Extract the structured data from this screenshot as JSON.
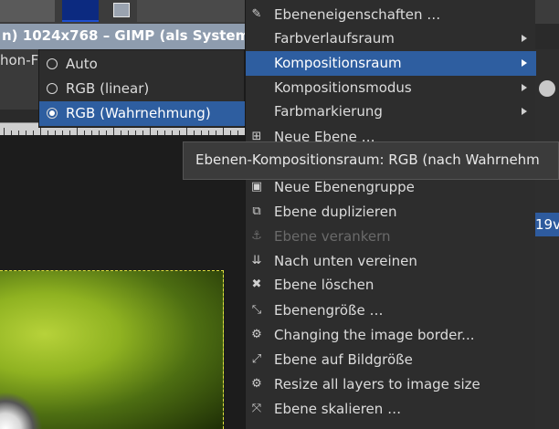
{
  "window": {
    "title": "n) 1024x768 – GIMP (als System",
    "cut_label": "hon-F",
    "right_cut_label": "19v"
  },
  "submenu": {
    "items": [
      {
        "label": "Auto",
        "selected": false
      },
      {
        "label": "RGB (linear)",
        "selected": false
      },
      {
        "label": "RGB (Wahrnehmung)",
        "selected": true
      }
    ]
  },
  "menu": {
    "items": [
      {
        "label": "Ebeneneigenschaften …",
        "icon": "layer-properties-icon",
        "glyph": "✎",
        "submenu": false,
        "disabled": false,
        "highlighted": false
      },
      {
        "label": "Farbverlaufsraum",
        "icon": "",
        "glyph": "",
        "submenu": true,
        "disabled": false,
        "highlighted": false
      },
      {
        "label": "Kompositionsraum",
        "icon": "",
        "glyph": "",
        "submenu": true,
        "disabled": false,
        "highlighted": true
      },
      {
        "label": "Kompositionsmodus",
        "icon": "",
        "glyph": "",
        "submenu": true,
        "disabled": false,
        "highlighted": false
      },
      {
        "label": "Farbmarkierung",
        "icon": "",
        "glyph": "",
        "submenu": true,
        "disabled": false,
        "highlighted": false
      },
      {
        "label": "Neue Ebene …",
        "icon": "new-layer-icon",
        "glyph": "⊞",
        "submenu": false,
        "disabled": false,
        "highlighted": false
      },
      {
        "label": "",
        "icon": "",
        "glyph": "",
        "submenu": false,
        "disabled": false,
        "highlighted": false
      },
      {
        "label": "Neue Ebenengruppe",
        "icon": "new-layer-group-icon",
        "glyph": "▣",
        "submenu": false,
        "disabled": false,
        "highlighted": false
      },
      {
        "label": "Ebene duplizieren",
        "icon": "duplicate-layer-icon",
        "glyph": "⧉",
        "submenu": false,
        "disabled": false,
        "highlighted": false
      },
      {
        "label": "Ebene verankern",
        "icon": "anchor-icon",
        "glyph": "⚓",
        "submenu": false,
        "disabled": true,
        "highlighted": false
      },
      {
        "label": "Nach unten vereinen",
        "icon": "merge-down-icon",
        "glyph": "⇊",
        "submenu": false,
        "disabled": false,
        "highlighted": false
      },
      {
        "label": "Ebene löschen",
        "icon": "delete-layer-icon",
        "glyph": "✖",
        "submenu": false,
        "disabled": false,
        "highlighted": false
      },
      {
        "label": "Ebenengröße …",
        "icon": "layer-size-icon",
        "glyph": "⤡",
        "submenu": false,
        "disabled": false,
        "highlighted": false
      },
      {
        "label": "Changing the image border...",
        "icon": "gear-icon",
        "glyph": "⚙",
        "submenu": false,
        "disabled": false,
        "highlighted": false
      },
      {
        "label": "Ebene auf Bildgröße",
        "icon": "layer-to-image-size-icon",
        "glyph": "⤢",
        "submenu": false,
        "disabled": false,
        "highlighted": false
      },
      {
        "label": "Resize all layers to image size",
        "icon": "gear-icon",
        "glyph": "⚙",
        "submenu": false,
        "disabled": false,
        "highlighted": false
      },
      {
        "label": "Ebene skalieren …",
        "icon": "scale-layer-icon",
        "glyph": "⤧",
        "submenu": false,
        "disabled": false,
        "highlighted": false
      }
    ]
  },
  "tooltip": {
    "text": "Ebenen-Kompositionsraum: RGB (nach Wahrnehm"
  },
  "colors": {
    "highlight": "#2e5ea0",
    "menu_bg": "#2d2d2d"
  }
}
